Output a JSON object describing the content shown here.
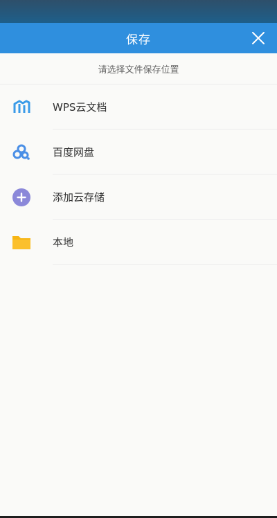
{
  "header": {
    "title": "保存",
    "close_icon": "close-icon",
    "accent_color": "#2f8fde"
  },
  "subtitle": "请选择文件保存位置",
  "options": [
    {
      "label": "WPS云文档",
      "icon": "wps-cloud-icon",
      "color": "#3a9be8"
    },
    {
      "label": "百度网盘",
      "icon": "baidu-netdisk-icon",
      "color": "#4a8fe6"
    },
    {
      "label": "添加云存储",
      "icon": "add-cloud-icon",
      "color": "#8b88d9"
    },
    {
      "label": "本地",
      "icon": "folder-icon",
      "color": "#f7b514"
    }
  ]
}
